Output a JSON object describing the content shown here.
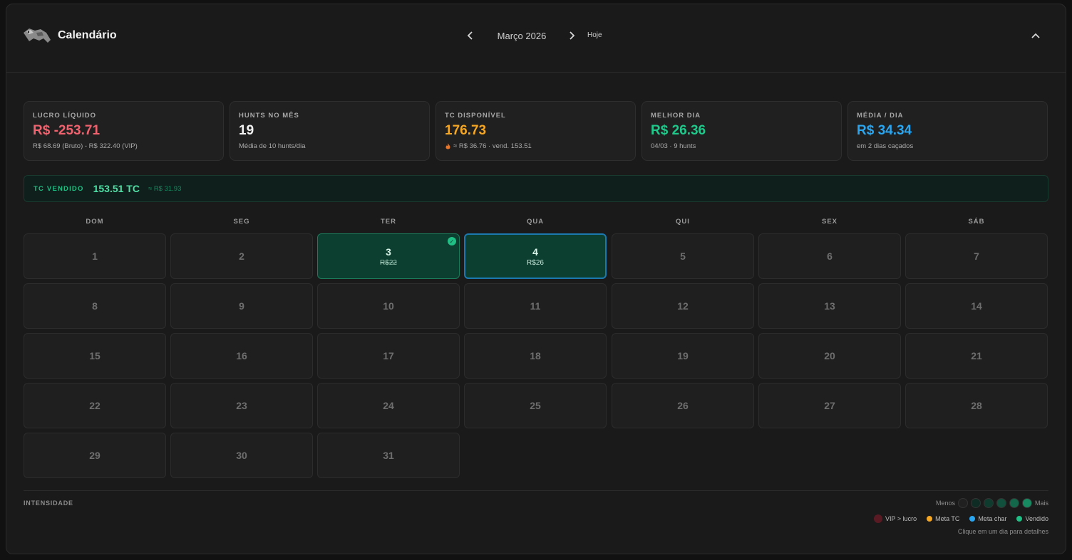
{
  "header": {
    "title": "Calendário",
    "month": "Março 2026",
    "today_label": "Hoje"
  },
  "stats": [
    {
      "label": "LUCRO LÍQUIDO",
      "value": "R$ -253.71",
      "sub": "R$ 68.69 (Bruto) - R$ 322.40 (VIP)",
      "color": "#f0626e"
    },
    {
      "label": "HUNTS NO MÊS",
      "value": "19",
      "sub": "Média de 10 hunts/dia",
      "color": "#f2f2f2"
    },
    {
      "label": "TC DISPONÍVEL",
      "value": "176.73",
      "sub": "≈ R$ 36.76 · vend. 153.51",
      "color": "#f5a623"
    },
    {
      "label": "MELHOR DIA",
      "value": "R$ 26.36",
      "sub": "04/03 · 9 hunts",
      "color": "#1fc98b"
    },
    {
      "label": "MÉDIA / DIA",
      "value": "R$ 34.34",
      "sub": "em 2 dias caçados",
      "color": "#2aa6f0"
    }
  ],
  "sold": {
    "label": "TC VENDIDO",
    "value": "153.51 TC",
    "approx": "≈ R$ 31.93"
  },
  "weekdays": [
    "DOM",
    "SEG",
    "TER",
    "QUA",
    "QUI",
    "SEX",
    "SÁB"
  ],
  "days": [
    {
      "n": "1"
    },
    {
      "n": "2"
    },
    {
      "n": "3",
      "amount": "R$22",
      "strike": true,
      "check": true,
      "active": true
    },
    {
      "n": "4",
      "amount": "R$26",
      "active": true,
      "selected": true
    },
    {
      "n": "5"
    },
    {
      "n": "6"
    },
    {
      "n": "7"
    },
    {
      "n": "8"
    },
    {
      "n": "9"
    },
    {
      "n": "10"
    },
    {
      "n": "11"
    },
    {
      "n": "12"
    },
    {
      "n": "13"
    },
    {
      "n": "14"
    },
    {
      "n": "15"
    },
    {
      "n": "16"
    },
    {
      "n": "17"
    },
    {
      "n": "18"
    },
    {
      "n": "19"
    },
    {
      "n": "20"
    },
    {
      "n": "21"
    },
    {
      "n": "22"
    },
    {
      "n": "23"
    },
    {
      "n": "24"
    },
    {
      "n": "25"
    },
    {
      "n": "26"
    },
    {
      "n": "27"
    },
    {
      "n": "28"
    },
    {
      "n": "29"
    },
    {
      "n": "30"
    },
    {
      "n": "31"
    }
  ],
  "footer": {
    "intensity_label": "INTENSIDADE",
    "less": "Menos",
    "more": "Mais",
    "scale_colors": [
      "#202020",
      "#0f2c24",
      "#0f3a2e",
      "#10503c",
      "#13684c",
      "#178a62"
    ],
    "legend": [
      {
        "label": "VIP > lucro",
        "color": "#5a1a24"
      },
      {
        "label": "Meta TC",
        "color": "#f5a623"
      },
      {
        "label": "Meta char",
        "color": "#2aa6f0"
      },
      {
        "label": "Vendido",
        "color": "#1fbf85"
      }
    ],
    "hint": "Clique em um dia para detalhes"
  }
}
